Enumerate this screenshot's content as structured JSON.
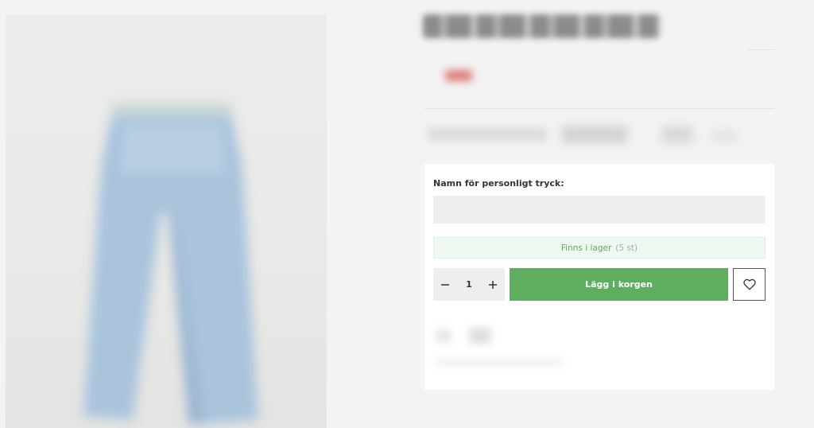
{
  "product": {
    "image_alt": "light blue denim jeans",
    "colors": {
      "background": "#f3f3f3",
      "accent_green": "#5fae60",
      "stock_bg": "#eef8ee",
      "stock_text": "#5fa960"
    }
  },
  "personalization": {
    "label": "Namn för personligt tryck:",
    "value": "",
    "placeholder": ""
  },
  "stock": {
    "status": "Finns i lager",
    "count": "(5 st)"
  },
  "quantity": {
    "decrement_icon": "minus-icon",
    "value": "1",
    "increment_icon": "plus-icon"
  },
  "cart": {
    "add_label": "Lägg i korgen"
  },
  "wishlist": {
    "icon": "heart-icon"
  }
}
